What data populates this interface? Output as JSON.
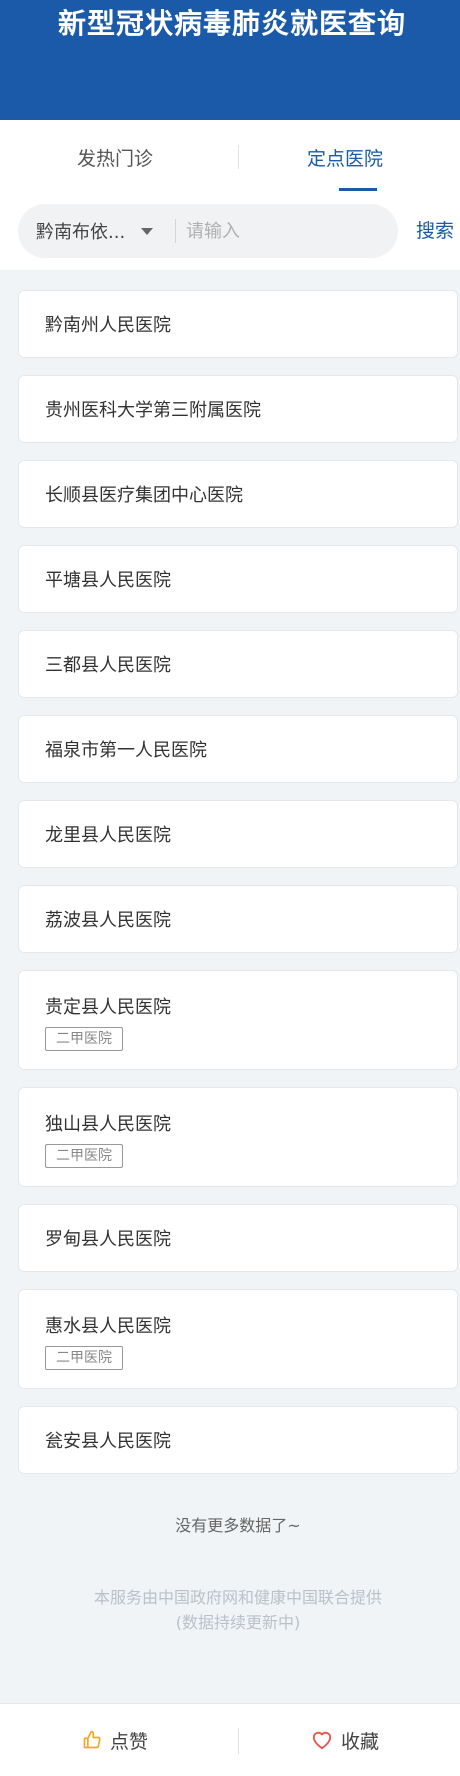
{
  "header": {
    "title": "新型冠状病毒肺炎就医查询"
  },
  "tabs": [
    {
      "label": "发热门诊",
      "active": false
    },
    {
      "label": "定点医院",
      "active": true
    }
  ],
  "search": {
    "region": "黔南布依...",
    "placeholder": "请输入",
    "value": "",
    "button_label": "搜索"
  },
  "hospitals": [
    {
      "name": "黔南州人民医院",
      "tag": ""
    },
    {
      "name": "贵州医科大学第三附属医院",
      "tag": ""
    },
    {
      "name": "长顺县医疗集团中心医院",
      "tag": ""
    },
    {
      "name": "平塘县人民医院",
      "tag": ""
    },
    {
      "name": "三都县人民医院",
      "tag": ""
    },
    {
      "name": "福泉市第一人民医院",
      "tag": ""
    },
    {
      "name": "龙里县人民医院",
      "tag": ""
    },
    {
      "name": "荔波县人民医院",
      "tag": ""
    },
    {
      "name": "贵定县人民医院",
      "tag": "二甲医院"
    },
    {
      "name": "独山县人民医院",
      "tag": "二甲医院"
    },
    {
      "name": "罗甸县人民医院",
      "tag": ""
    },
    {
      "name": "惠水县人民医院",
      "tag": "二甲医院"
    },
    {
      "name": "瓮安县人民医院",
      "tag": ""
    }
  ],
  "list_end_text": "没有更多数据了~",
  "footer": {
    "line1": "本服务由中国政府网和健康中国联合提供",
    "line2": "(数据持续更新中)"
  },
  "bottom_bar": {
    "like_label": "点赞",
    "like_icon": "thumbs-up-icon",
    "favorite_label": "收藏",
    "favorite_icon": "heart-icon"
  },
  "colors": {
    "brand": "#1b5aa8",
    "background": "#f0f4f7",
    "like_icon": "#f5a623",
    "favorite_icon": "#e8534a"
  }
}
